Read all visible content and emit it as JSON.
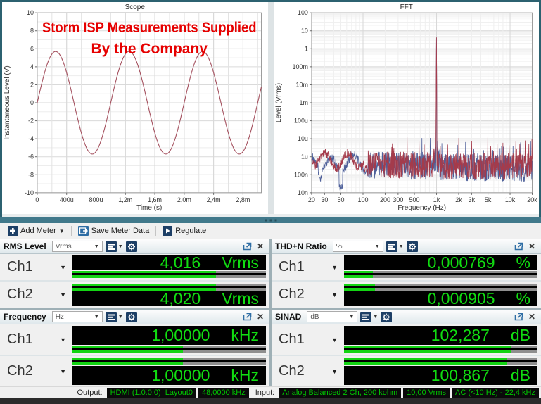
{
  "toolbar": {
    "add_meter": "Add Meter",
    "save_meter_data": "Save Meter Data",
    "regulate": "Regulate"
  },
  "meters": [
    {
      "title": "RMS Level",
      "unit_selector": "Vrms",
      "channels": [
        {
          "name": "Ch1",
          "value": "4,016",
          "unit": "Vrms",
          "bar_pct": 74
        },
        {
          "name": "Ch2",
          "value": "4,020",
          "unit": "Vrms",
          "bar_pct": 74
        }
      ]
    },
    {
      "title": "THD+N Ratio",
      "unit_selector": "%",
      "channels": [
        {
          "name": "Ch1",
          "value": "0,000769",
          "unit": "%",
          "bar_pct": 15
        },
        {
          "name": "Ch2",
          "value": "0,000905",
          "unit": "%",
          "bar_pct": 16
        }
      ]
    },
    {
      "title": "Frequency",
      "unit_selector": "Hz",
      "channels": [
        {
          "name": "Ch1",
          "value": "1,00000",
          "unit": "kHz",
          "bar_pct": 57
        },
        {
          "name": "Ch2",
          "value": "1,00000",
          "unit": "kHz",
          "bar_pct": 57
        }
      ]
    },
    {
      "title": "SINAD",
      "unit_selector": "dB",
      "channels": [
        {
          "name": "Ch1",
          "value": "102,287",
          "unit": "dB",
          "bar_pct": 86
        },
        {
          "name": "Ch2",
          "value": "100,867",
          "unit": "dB",
          "bar_pct": 84
        }
      ]
    }
  ],
  "statusbar": {
    "output_label": "Output:",
    "input_label": "Input:",
    "output_badges": [
      "HDMI (1.0.0.0)  Layout0",
      "48,0000 kHz"
    ],
    "input_badges": [
      "Analog Balanced 2 Ch, 200 kohm",
      "10,00 Vrms",
      "AC (<10 Hz) - 22,4 kHz"
    ]
  },
  "colors": {
    "accent_teal": "#2c6170",
    "meter_green": "#13d413",
    "value_green": "#11dd11",
    "badge_green": "#00c400",
    "annotation_red": "#e60000",
    "trace_red": "#a4505e",
    "trace_blue": "#4d5f99",
    "icon_navy": "#1d3f66",
    "icon_blue": "#2e6da4"
  },
  "chart_data": [
    {
      "type": "line",
      "title": "Scope",
      "xlabel": "Time (s)",
      "ylabel": "Instantaneous Level (V)",
      "xlim": [
        0,
        0.00305
      ],
      "ylim": [
        -10,
        10
      ],
      "x_minor_step": 0.0002,
      "y_major_step": 2,
      "y_minor_step": 1,
      "x_ticks": [
        {
          "v": 0,
          "label": "0"
        },
        {
          "v": 0.0004,
          "label": "400u"
        },
        {
          "v": 0.0008,
          "label": "800u"
        },
        {
          "v": 0.0012,
          "label": "1,2m"
        },
        {
          "v": 0.0016,
          "label": "1,6m"
        },
        {
          "v": 0.002,
          "label": "2,0m"
        },
        {
          "v": 0.0024,
          "label": "2,4m"
        },
        {
          "v": 0.0028,
          "label": "2,8m"
        }
      ],
      "series": [
        {
          "name": "Ch1",
          "color": "#a4505e",
          "waveform": "sine",
          "amplitude_v": 5.7,
          "frequency_hz": 1000,
          "phase_deg": 0
        }
      ],
      "annotation": {
        "lines": [
          "Storm ISP Measurements Supplied",
          "By the Company"
        ],
        "color": "#e60000"
      },
      "grid": true,
      "legend": "none"
    },
    {
      "type": "line",
      "title": "FFT",
      "xlabel": "Frequency (Hz)",
      "ylabel": "Level (Vrms)",
      "x_scale": "log",
      "y_scale": "log",
      "xlim": [
        20,
        20000
      ],
      "ylim": [
        1e-08,
        100
      ],
      "x_ticks": [
        {
          "v": 20,
          "label": "20"
        },
        {
          "v": 30,
          "label": "30"
        },
        {
          "v": 50,
          "label": "50"
        },
        {
          "v": 100,
          "label": "100"
        },
        {
          "v": 200,
          "label": "200"
        },
        {
          "v": 300,
          "label": "300"
        },
        {
          "v": 500,
          "label": "500"
        },
        {
          "v": 1000,
          "label": "1k"
        },
        {
          "v": 2000,
          "label": "2k"
        },
        {
          "v": 3000,
          "label": "3k"
        },
        {
          "v": 5000,
          "label": "5k"
        },
        {
          "v": 10000,
          "label": "10k"
        },
        {
          "v": 20000,
          "label": "20k"
        }
      ],
      "y_ticks": [
        {
          "v": 100,
          "label": "100"
        },
        {
          "v": 10,
          "label": "10"
        },
        {
          "v": 1,
          "label": "1"
        },
        {
          "v": 0.1,
          "label": "100m"
        },
        {
          "v": 0.01,
          "label": "10m"
        },
        {
          "v": 0.001,
          "label": "1m"
        },
        {
          "v": 0.0001,
          "label": "100u"
        },
        {
          "v": 1e-05,
          "label": "10u"
        },
        {
          "v": 1e-06,
          "label": "1u"
        },
        {
          "v": 1e-07,
          "label": "100n"
        },
        {
          "v": 1e-08,
          "label": "10n"
        }
      ],
      "seed": 20250713,
      "points": 850,
      "series": [
        {
          "name": "Ch1",
          "color": "#4d5f99",
          "noise_floor": [
            [
              20,
              5.5e-07
            ],
            [
              45,
              3.5e-07
            ],
            [
              70,
              6e-07
            ],
            [
              120,
              3.5e-07
            ],
            [
              300,
              3e-07
            ],
            [
              1000,
              2.8e-07
            ],
            [
              3000,
              2.5e-07
            ],
            [
              20000,
              2.2e-07
            ]
          ],
          "dips": [
            [
              50,
              0.1
            ],
            [
              26,
              0.35
            ]
          ],
          "peaks": [
            [
              1000,
              4.1
            ],
            [
              1080,
              2.5e-06
            ],
            [
              2000,
              2.5e-06
            ],
            [
              5000,
              2.2e-06
            ],
            [
              7300,
              3e-06
            ],
            [
              11000,
              4e-06
            ],
            [
              15000,
              5e-06
            ],
            [
              19000,
              7e-06
            ]
          ]
        },
        {
          "name": "Ch2",
          "color": "#a43b4b",
          "noise_floor": [
            [
              20,
              9e-07
            ],
            [
              45,
              5e-07
            ],
            [
              70,
              7e-07
            ],
            [
              120,
              4e-07
            ],
            [
              300,
              3.5e-07
            ],
            [
              1000,
              3.2e-07
            ],
            [
              3000,
              3e-07
            ],
            [
              20000,
              2.8e-07
            ]
          ],
          "dips": [
            [
              110,
              0.3
            ]
          ],
          "peaks": [
            [
              1000,
              4.3
            ],
            [
              2000,
              1.1e-05
            ],
            [
              3000,
              7.5e-06
            ],
            [
              5000,
              1.4e-05
            ],
            [
              6700,
              5e-06
            ],
            [
              8000,
              6e-06
            ],
            [
              9700,
              4.5e-06
            ],
            [
              12000,
              7e-06
            ],
            [
              13500,
              5e-06
            ],
            [
              16000,
              8e-06
            ],
            [
              18000,
              5e-06
            ],
            [
              19800,
              1e-05
            ]
          ]
        }
      ],
      "grid": true,
      "legend": "none"
    }
  ]
}
